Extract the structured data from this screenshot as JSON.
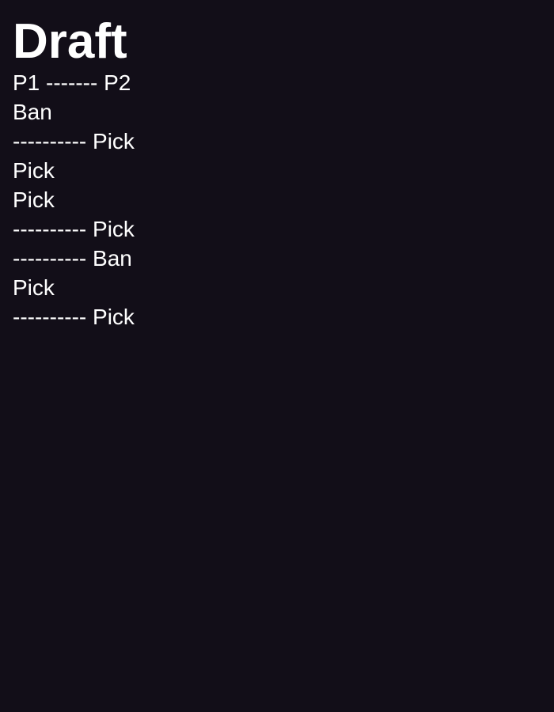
{
  "page": {
    "title": "Draft",
    "header_line": "P1 ------- P2",
    "lines": [
      "Ban",
      "---------- Pick",
      "Pick",
      "Pick",
      "---------- Pick",
      "---------- Ban",
      "Pick",
      "---------- Pick"
    ]
  }
}
